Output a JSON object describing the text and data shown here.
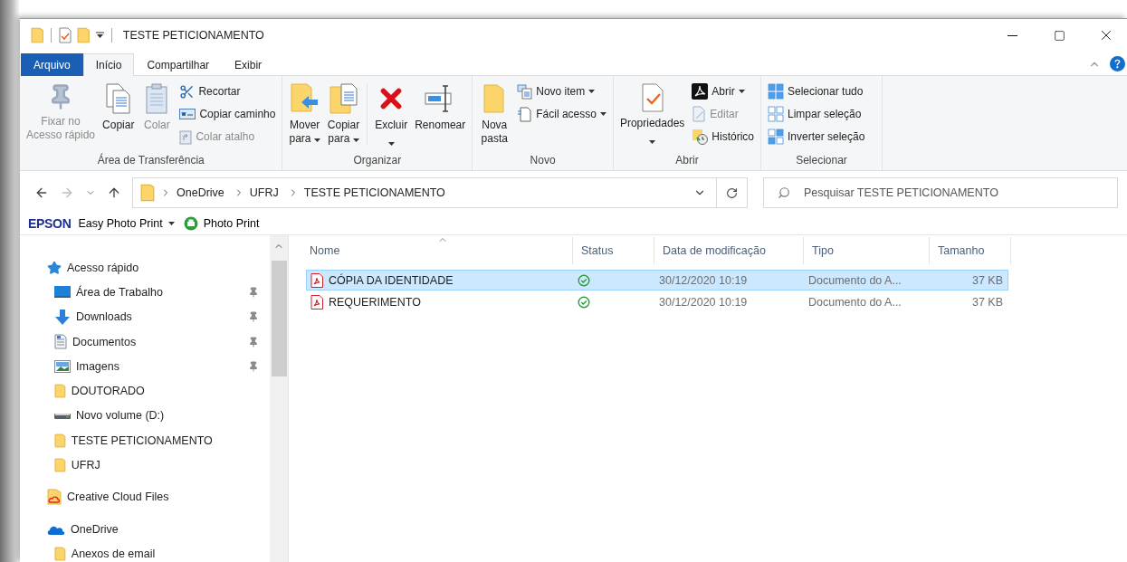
{
  "window": {
    "title": "TESTE PETICIONAMENTO"
  },
  "ribbon": {
    "tabs": [
      {
        "label": "Arquivo",
        "kind": "file",
        "selected": false
      },
      {
        "label": "Início",
        "kind": "tab",
        "selected": true
      },
      {
        "label": "Compartilhar",
        "kind": "tab",
        "selected": false
      },
      {
        "label": "Exibir",
        "kind": "tab",
        "selected": false
      }
    ],
    "groups": [
      {
        "label": "Área de Transferência",
        "commands": [
          {
            "kind": "large",
            "label": "Fixar no\nAcesso rápido",
            "disabled": true
          },
          {
            "kind": "large",
            "label": "Copiar",
            "disabled": false
          },
          {
            "kind": "large",
            "label": "Colar",
            "disabled": true
          },
          {
            "kind": "small",
            "label": "Recortar",
            "disabled": false
          },
          {
            "kind": "small",
            "label": "Copiar caminho",
            "disabled": false
          },
          {
            "kind": "small",
            "label": "Colar atalho",
            "disabled": true
          }
        ]
      },
      {
        "label": "Organizar",
        "commands": [
          {
            "kind": "large",
            "label": "Mover\npara",
            "disabled": false,
            "dropdown": true
          },
          {
            "kind": "large",
            "label": "Copiar\npara",
            "disabled": false,
            "dropdown": true
          },
          {
            "kind": "large",
            "label": "Excluir",
            "disabled": false,
            "dropdown": true,
            "divider_before": true
          },
          {
            "kind": "large",
            "label": "Renomear",
            "disabled": false
          }
        ]
      },
      {
        "label": "Novo",
        "commands": [
          {
            "kind": "large",
            "label": "Nova\npasta",
            "disabled": false
          },
          {
            "kind": "small",
            "label": "Novo item",
            "disabled": false,
            "dropdown": true
          },
          {
            "kind": "small",
            "label": "Fácil acesso",
            "disabled": false,
            "dropdown": true
          }
        ]
      },
      {
        "label": "Abrir",
        "commands": [
          {
            "kind": "large",
            "label": "Propriedades",
            "disabled": false,
            "dropdown": true
          },
          {
            "kind": "small",
            "label": "Abrir",
            "disabled": false,
            "dropdown": true
          },
          {
            "kind": "small",
            "label": "Editar",
            "disabled": true
          },
          {
            "kind": "small",
            "label": "Histórico",
            "disabled": false
          }
        ]
      },
      {
        "label": "Selecionar",
        "commands": [
          {
            "kind": "small",
            "label": "Selecionar tudo",
            "disabled": false
          },
          {
            "kind": "small",
            "label": "Limpar seleção",
            "disabled": false
          },
          {
            "kind": "small",
            "label": "Inverter seleção",
            "disabled": false
          }
        ]
      }
    ]
  },
  "navigation": {
    "back_disabled": false,
    "forward_disabled": true
  },
  "address": {
    "crumbs": [
      "OneDrive",
      "UFRJ",
      "TESTE PETICIONAMENTO"
    ]
  },
  "search": {
    "placeholder": "Pesquisar TESTE PETICIONAMENTO"
  },
  "epson_toolbar": {
    "brand": "EPSON",
    "items": [
      {
        "label": "Easy Photo Print",
        "kind": "menu"
      },
      {
        "label": "Photo Print",
        "kind": "printer"
      }
    ]
  },
  "nav_pane": {
    "items": [
      {
        "label": "Acesso rápido",
        "kind": "quick-access",
        "children": [
          {
            "label": "Área de Trabalho",
            "kind": "desktop",
            "pinned": true
          },
          {
            "label": "Downloads",
            "kind": "downloads",
            "pinned": true
          },
          {
            "label": "Documentos",
            "kind": "documents",
            "pinned": true
          },
          {
            "label": "Imagens",
            "kind": "pictures",
            "pinned": true
          },
          {
            "label": "DOUTORADO",
            "kind": "folder",
            "pinned": false
          },
          {
            "label": "Novo volume (D:)",
            "kind": "drive",
            "pinned": false
          },
          {
            "label": "TESTE PETICIONAMENTO",
            "kind": "folder",
            "pinned": false
          },
          {
            "label": "UFRJ",
            "kind": "folder",
            "pinned": false
          }
        ]
      },
      {
        "label": "Creative Cloud Files",
        "kind": "cloud-files"
      },
      {
        "label": "OneDrive",
        "kind": "onedrive",
        "children": [
          {
            "label": "Anexos de email",
            "kind": "folder",
            "pinned": false
          }
        ]
      }
    ]
  },
  "file_list": {
    "columns": [
      {
        "label": "Nome",
        "sorted": true
      },
      {
        "label": "Status",
        "sorted": false
      },
      {
        "label": "Data de modificação",
        "sorted": false
      },
      {
        "label": "Tipo",
        "sorted": false
      },
      {
        "label": "Tamanho",
        "sorted": false
      }
    ],
    "rows": [
      {
        "name": "CÓPIA DA IDENTIDADE",
        "date": "30/12/2020 10:19",
        "type": "Documento do A...",
        "size": "37 KB",
        "selected": true
      },
      {
        "name": "REQUERIMENTO",
        "date": "30/12/2020 10:19",
        "type": "Documento do A...",
        "size": "37 KB",
        "selected": false
      }
    ]
  }
}
